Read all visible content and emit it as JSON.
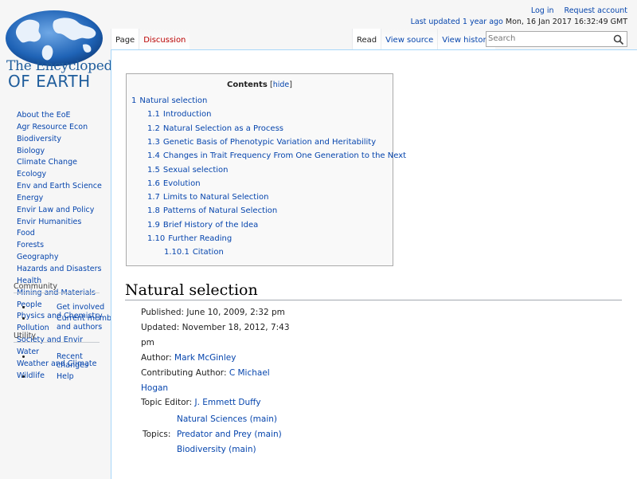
{
  "logo": {
    "line1": "The Encyclopedia",
    "line2": "OF EARTH"
  },
  "personal": {
    "login": "Log in",
    "request_account": "Request account",
    "last_updated_link": "Last updated 1 year ago",
    "last_updated_date": "Mon, 16 Jan 2017 16:32:49 GMT"
  },
  "tabs": {
    "left": [
      "Page",
      "Discussion"
    ],
    "right": [
      "Read",
      "View source",
      "View history"
    ]
  },
  "search": {
    "placeholder": "Search",
    "icon": "magnifier-icon"
  },
  "sidebar": {
    "nav": [
      "About the EoE",
      "Agr Resource Econ",
      "Biodiversity",
      "Biology",
      "Climate Change",
      "Ecology",
      "Env and Earth Science",
      "Energy",
      "Envir Law and Policy",
      "Envir Humanities",
      "Food",
      "Forests",
      "Geography",
      "Hazards and Disasters",
      "Health",
      "Mining and Materials",
      "People",
      "Physics and Chemistry",
      "Pollution",
      "Society and Envir",
      "Water",
      "Weather and Climate",
      "Wildlife"
    ],
    "community": {
      "heading": "Community",
      "items": [
        "Get involved",
        "Current members and authors"
      ]
    },
    "utility": {
      "heading": "Utility",
      "items": [
        "Recent changes",
        "Help"
      ]
    }
  },
  "toc": {
    "title": "Contents",
    "hide_open": "[",
    "hide": "hide",
    "hide_close": "]",
    "items": [
      {
        "num": "1",
        "text": "Natural selection"
      },
      {
        "num": "1.1",
        "text": "Introduction"
      },
      {
        "num": "1.2",
        "text": "Natural Selection as a Process"
      },
      {
        "num": "1.3",
        "text": "Genetic Basis of Phenotypic Variation and Heritability"
      },
      {
        "num": "1.4",
        "text": "Changes in Trait Frequency From One Generation to the Next"
      },
      {
        "num": "1.5",
        "text": "Sexual selection"
      },
      {
        "num": "1.6",
        "text": "Evolution"
      },
      {
        "num": "1.7",
        "text": "Limits to Natural Selection"
      },
      {
        "num": "1.8",
        "text": "Patterns of Natural Selection"
      },
      {
        "num": "1.9",
        "text": "Brief History of the Idea"
      },
      {
        "num": "1.10",
        "text": "Further Reading"
      },
      {
        "num": "1.10.1",
        "text": "Citation"
      }
    ]
  },
  "article": {
    "heading": "Natural selection",
    "published": "Published: June 10, 2009, 2:32 pm",
    "updated_1": "Updated: November 18, 2012, 7:43",
    "updated_2": "pm",
    "author_label": "Author: ",
    "author": "Mark McGinley",
    "contrib_label": "Contributing Author: ",
    "contrib_1": "C Michael",
    "contrib_2": "Hogan",
    "editor_label": "Topic Editor: ",
    "editor": "J. Emmett Duffy",
    "topics_label": "Topics:",
    "topics": [
      "Natural Sciences (main)",
      "Predator and Prey (main)",
      "Biodiversity (main)"
    ]
  }
}
